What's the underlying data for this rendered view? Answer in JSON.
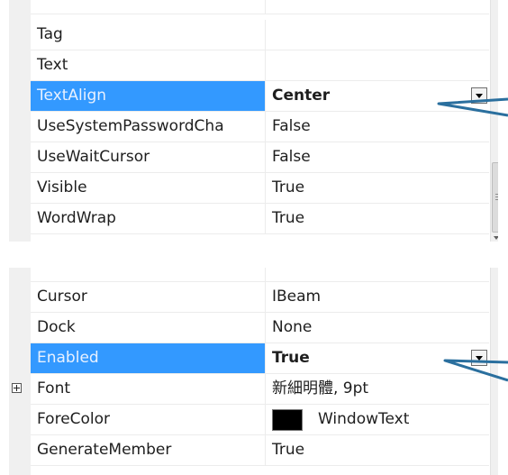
{
  "top_grid": {
    "rows": [
      {
        "name": "Tag",
        "value": ""
      },
      {
        "name": "Text",
        "value": ""
      },
      {
        "name": "TextAlign",
        "value": "Center"
      },
      {
        "name": "UseSystemPasswordCha",
        "value": "False"
      },
      {
        "name": "UseWaitCursor",
        "value": "False"
      },
      {
        "name": "Visible",
        "value": "True"
      },
      {
        "name": "WordWrap",
        "value": "True"
      }
    ]
  },
  "bottom_grid": {
    "rows": [
      {
        "name": "Cursor",
        "value": "IBeam"
      },
      {
        "name": "Dock",
        "value": "None"
      },
      {
        "name": "Enabled",
        "value": "True"
      },
      {
        "name": "Font",
        "value": "新細明體, 9pt"
      },
      {
        "name": "ForeColor",
        "value": "WindowText"
      },
      {
        "name": "GenerateMember",
        "value": "True"
      }
    ]
  },
  "colors": {
    "selection": "#3399ff",
    "forecolor_swatch": "#000000",
    "pointer": "#2a6f9e"
  },
  "icons": {
    "dropdown": "chevron-down-icon",
    "expand": "plus-box-icon",
    "scrollbar_grip": "grip-icon"
  }
}
